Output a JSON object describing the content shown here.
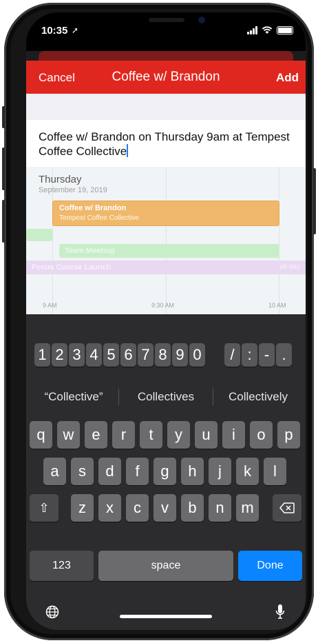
{
  "status_bar": {
    "time": "10:35"
  },
  "nav": {
    "cancel": "Cancel",
    "title": "Coffee w/ Brandon",
    "add": "Add"
  },
  "input": {
    "text": "Coffee w/ Brandon on Thursday 9am at Tempest Coffee Collective"
  },
  "calendar": {
    "day": "Thursday",
    "date": "September 19, 2019",
    "events": {
      "coffee_title": "Coffee w/ Brandon",
      "coffee_location": "Tempest Coffee Collective",
      "team_meeting": "Team Meeting",
      "focus": "Focus Course Launch",
      "focus_all_day": "all-day"
    },
    "axis": [
      "9 AM",
      "9:30 AM",
      "10 AM"
    ]
  },
  "keyboard": {
    "numbers": [
      "1",
      "2",
      "3",
      "4",
      "5",
      "6",
      "7",
      "8",
      "9",
      "0"
    ],
    "punct": [
      "/",
      ":",
      "-",
      "."
    ],
    "suggestions": [
      "“Collective”",
      "Collectives",
      "Collectively"
    ],
    "row1": [
      "q",
      "w",
      "e",
      "r",
      "t",
      "y",
      "u",
      "i",
      "o",
      "p"
    ],
    "row2": [
      "a",
      "s",
      "d",
      "f",
      "g",
      "h",
      "j",
      "k",
      "l"
    ],
    "row3": [
      "z",
      "x",
      "c",
      "v",
      "b",
      "n",
      "m"
    ],
    "mode": "123",
    "space": "space",
    "done": "Done"
  },
  "colors": {
    "nav_red": "#e0271f",
    "coffee_event": "#f0b86b",
    "green_event": "#c8eec9",
    "purple_event": "#e9d8f2",
    "done_blue": "#0a84ff"
  }
}
